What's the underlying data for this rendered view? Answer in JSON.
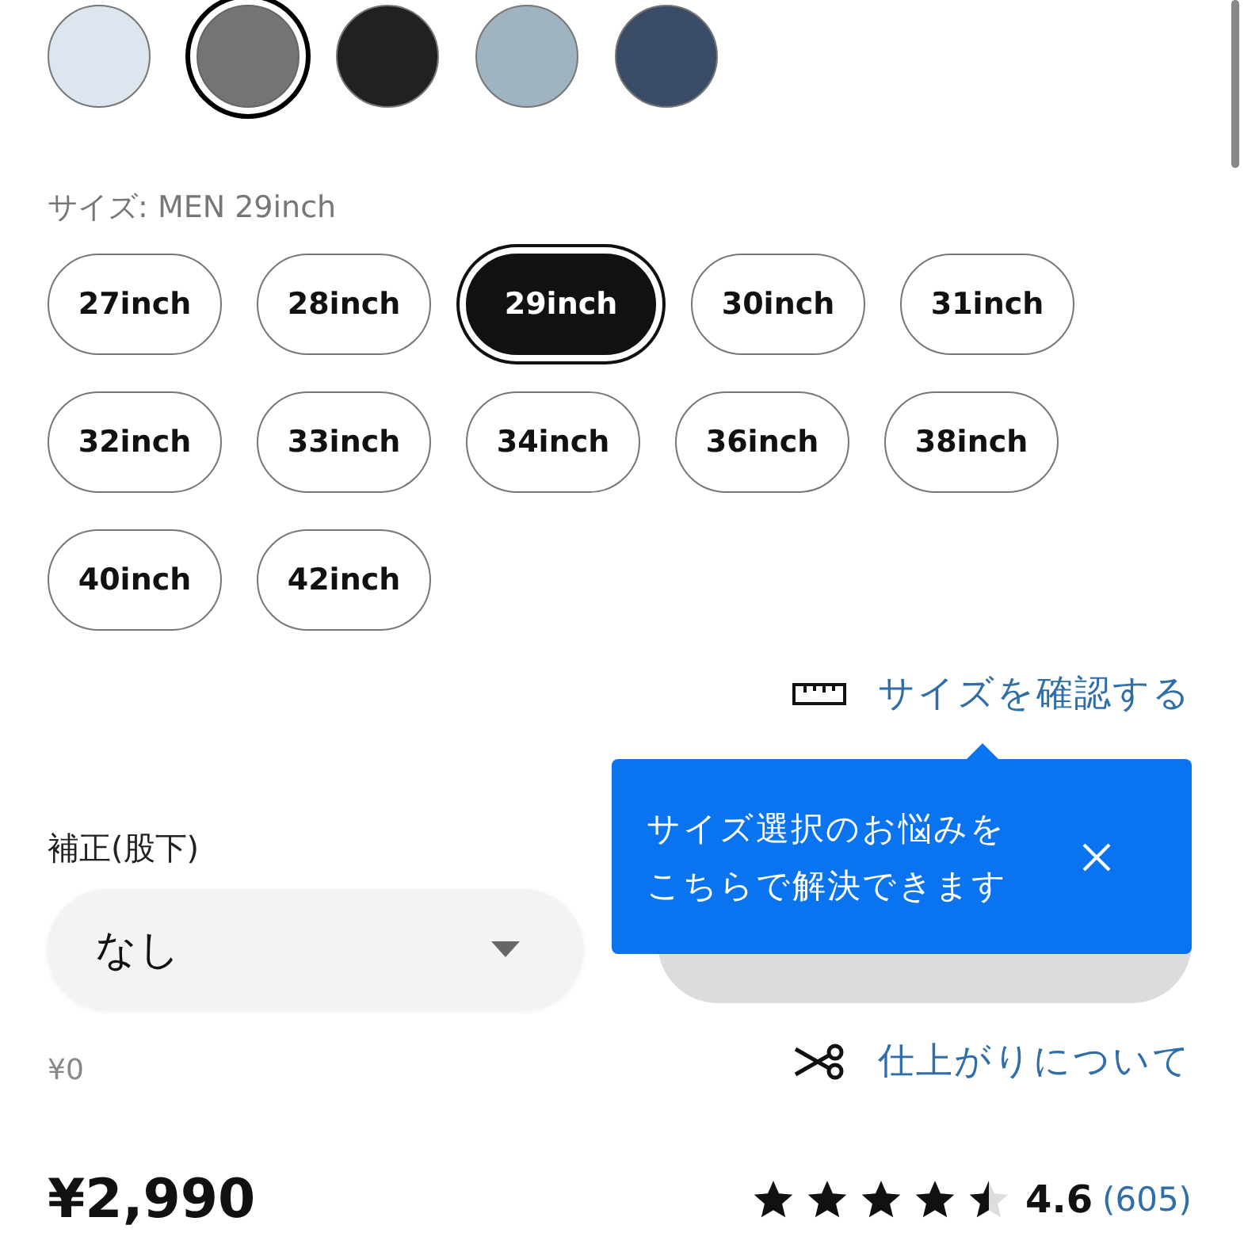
{
  "colors": [
    {
      "color": "#dde6ee",
      "selected": false
    },
    {
      "color": "#757375",
      "selected": true
    },
    {
      "color": "#222122",
      "selected": false
    },
    {
      "color": "#9fb3c0",
      "selected": false
    },
    {
      "color": "#3b4d66",
      "selected": false
    }
  ],
  "size_label": "サイズ: MEN 29inch",
  "sizes": [
    {
      "label": "27inch",
      "selected": false
    },
    {
      "label": "28inch",
      "selected": false
    },
    {
      "label": "29inch",
      "selected": true
    },
    {
      "label": "30inch",
      "selected": false
    },
    {
      "label": "31inch",
      "selected": false
    },
    {
      "label": "32inch",
      "selected": false
    },
    {
      "label": "33inch",
      "selected": false
    },
    {
      "label": "34inch",
      "selected": false
    },
    {
      "label": "36inch",
      "selected": false
    },
    {
      "label": "38inch",
      "selected": false
    },
    {
      "label": "40inch",
      "selected": false
    },
    {
      "label": "42inch",
      "selected": false
    }
  ],
  "size_guide_link": "サイズを確認する",
  "tooltip": {
    "lines": [
      "サイズ選択のお悩みを",
      "こちらで解決できます"
    ]
  },
  "alteration": {
    "label": "補正(股下)",
    "value": "なし",
    "price": "¥0"
  },
  "finish_link": "仕上がりについて",
  "price": "¥2,990",
  "rating": {
    "stars": 4.5,
    "score": "4.6",
    "count": "(605)"
  }
}
